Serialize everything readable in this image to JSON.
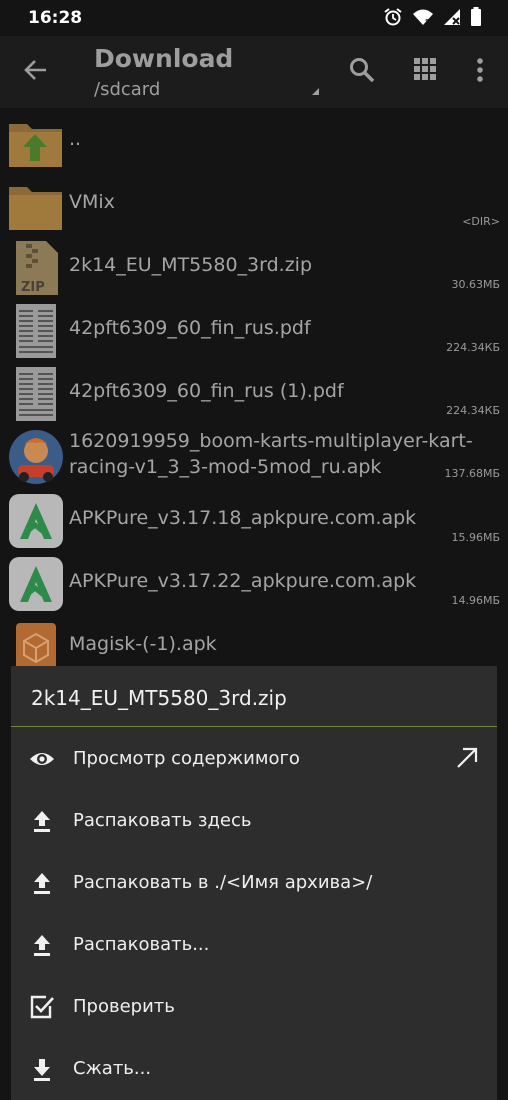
{
  "status": {
    "time": "16:28"
  },
  "appbar": {
    "title": "Download",
    "path": "/sdcard"
  },
  "files": [
    {
      "name": "..",
      "size": "",
      "icon": "folder-up-icon"
    },
    {
      "name": "VMix",
      "size": "<DIR>",
      "icon": "folder-icon"
    },
    {
      "name": "2k14_EU_MT5580_3rd.zip",
      "size": "30.63МБ",
      "icon": "zip-icon"
    },
    {
      "name": "42pft6309_60_fin_rus.pdf",
      "size": "224.34КБ",
      "icon": "pdf-icon"
    },
    {
      "name": "42pft6309_60_fin_rus (1).pdf",
      "size": "224.34КБ",
      "icon": "pdf-icon"
    },
    {
      "name": "1620919959_boom-karts-multiplayer-kart-racing-v1_3_3-mod-5mod_ru.apk",
      "size": "137.68МБ",
      "icon": "game-apk-icon"
    },
    {
      "name": "APKPure_v3.17.18_apkpure.com.apk",
      "size": "15.96МБ",
      "icon": "apkpure-icon"
    },
    {
      "name": "APKPure_v3.17.22_apkpure.com.apk",
      "size": "14.96МБ",
      "icon": "apkpure-icon"
    },
    {
      "name": "Magisk-(-1).apk",
      "size": "",
      "icon": "package-icon"
    }
  ],
  "sheet": {
    "title": "2k14_EU_MT5580_3rd.zip",
    "items": [
      {
        "label": "Просмотр содержимого",
        "icon": "eye-icon"
      },
      {
        "label": "Распаковать здесь",
        "icon": "upload-icon"
      },
      {
        "label": "Распаковать в ./<Имя архива>/",
        "icon": "upload-icon"
      },
      {
        "label": "Распаковать...",
        "icon": "upload-icon"
      },
      {
        "label": "Проверить",
        "icon": "checkbox-icon"
      },
      {
        "label": "Сжать...",
        "icon": "download-icon"
      }
    ]
  }
}
